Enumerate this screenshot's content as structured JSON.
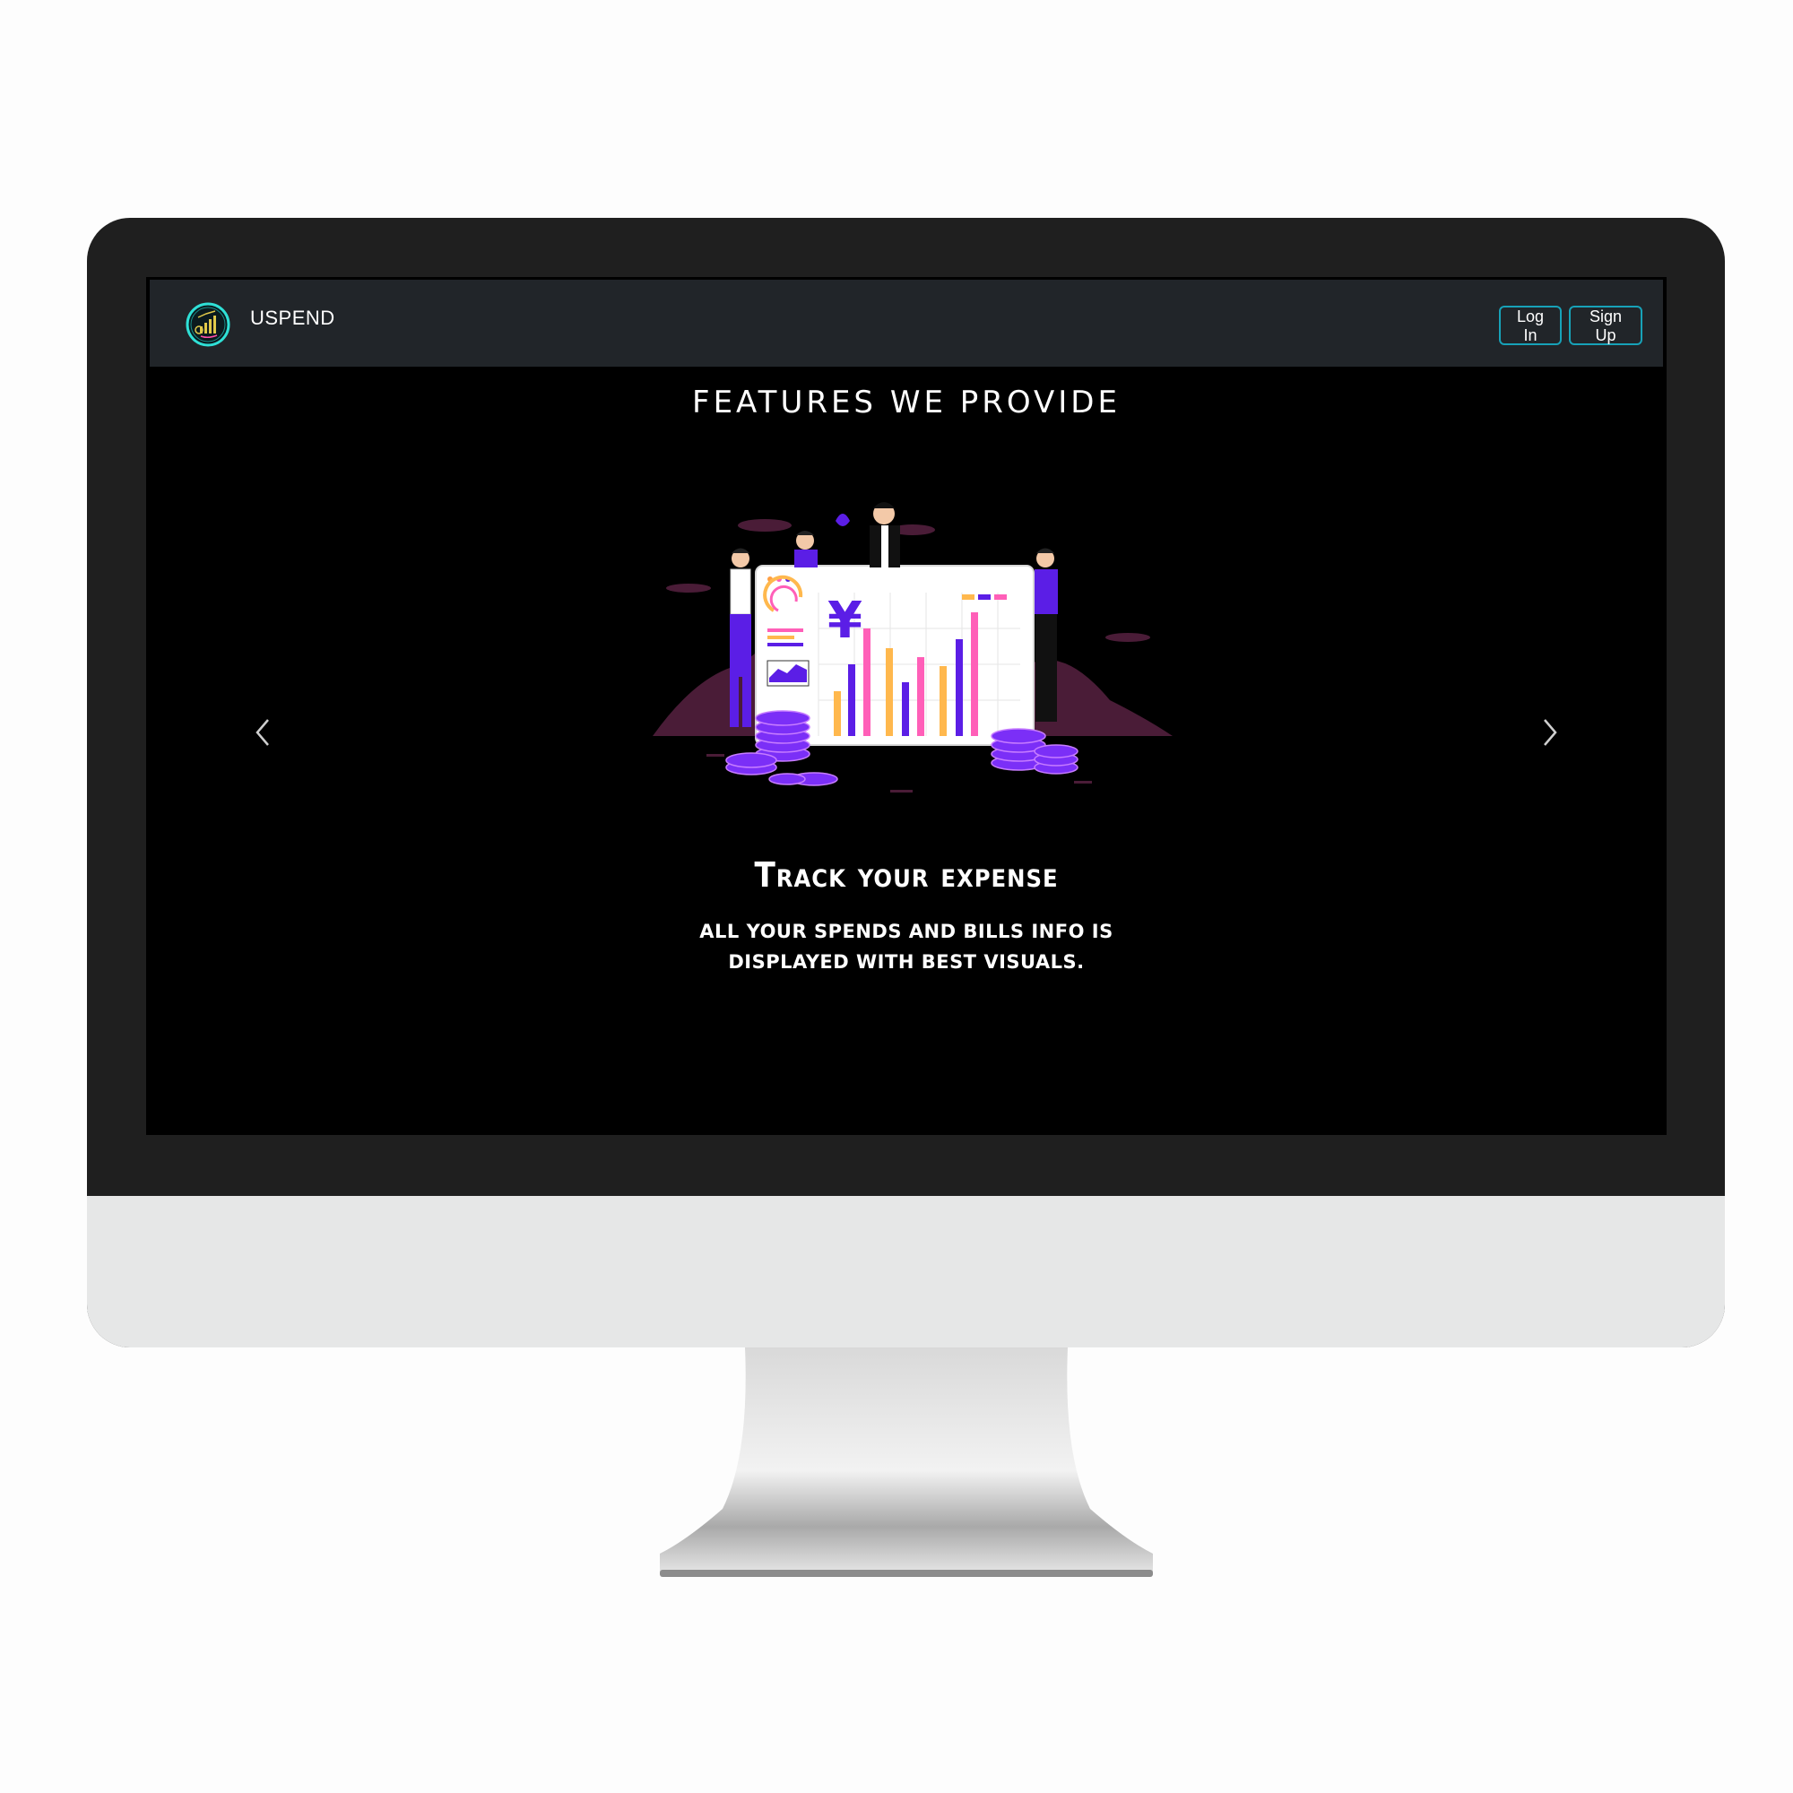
{
  "navbar": {
    "brand": "USPEND",
    "login_label": "Log In",
    "signup_label": "Sign Up"
  },
  "main": {
    "section_title": "FEATURES WE PROVIDE",
    "slide": {
      "title": "Track your expense",
      "description": "All your spends and bills info is displayed with best visuals.",
      "illustration_currency": "¥"
    }
  },
  "colors": {
    "accent": "#17a2b8",
    "navbar_bg": "#212529",
    "screen_bg": "#000000",
    "purple": "#5b1ee6",
    "pink": "#ff5fb8",
    "orange": "#ffb84d"
  },
  "icons": {
    "prev": "chevron-left-icon",
    "next": "chevron-right-icon",
    "logo": "uspend-logo-icon"
  }
}
